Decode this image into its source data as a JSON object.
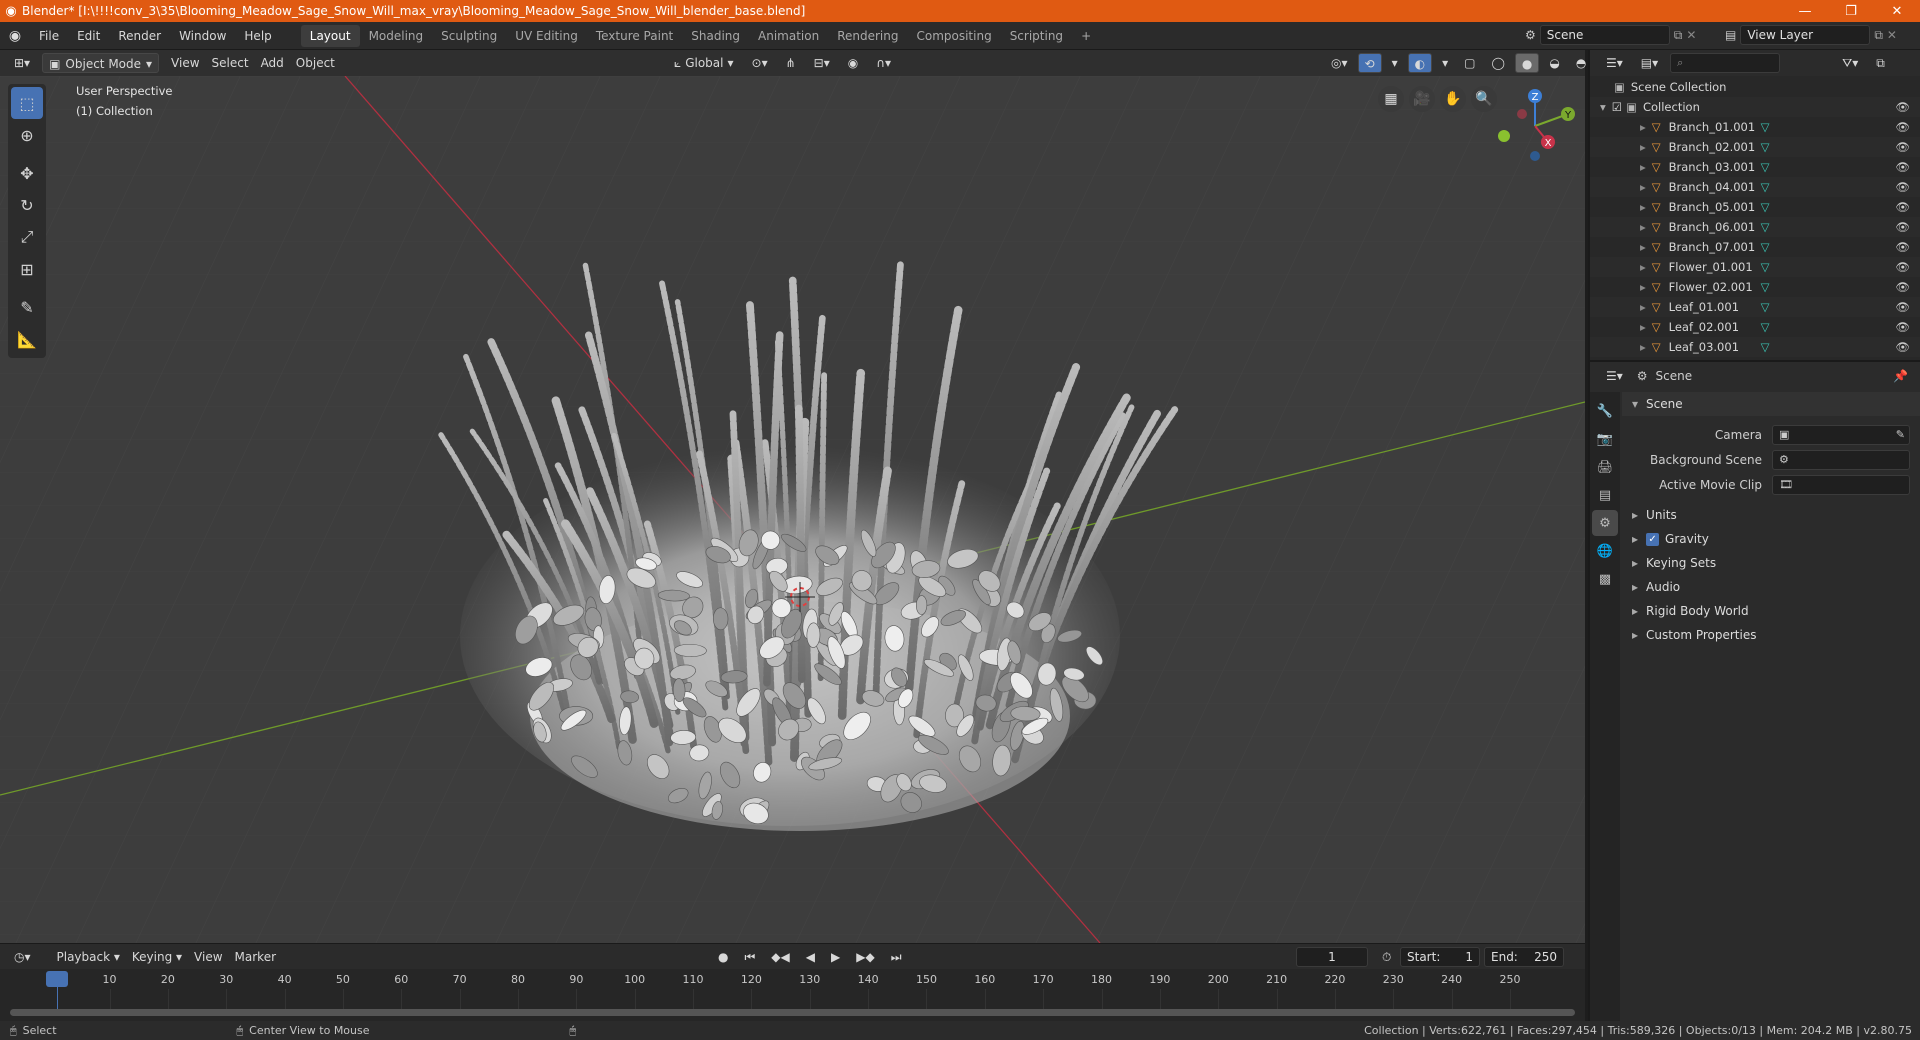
{
  "window": {
    "title": "Blender* [I:\\!!!!conv_3\\35\\Blooming_Meadow_Sage_Snow_Will_max_vray\\Blooming_Meadow_Sage_Snow_Will_blender_base.blend]",
    "minimize": "—",
    "maximize": "❐",
    "close": "✕"
  },
  "menubar": {
    "items": [
      "File",
      "Edit",
      "Render",
      "Window",
      "Help"
    ],
    "workspaces": [
      "Layout",
      "Modeling",
      "Sculpting",
      "UV Editing",
      "Texture Paint",
      "Shading",
      "Animation",
      "Rendering",
      "Compositing",
      "Scripting"
    ],
    "active_workspace": "Layout",
    "add_tab": "+",
    "scene_name": "Scene",
    "view_layer_name": "View Layer"
  },
  "viewport_header": {
    "mode": "Object Mode",
    "menus": [
      "View",
      "Select",
      "Add",
      "Object"
    ],
    "orientation": "Global"
  },
  "viewport": {
    "perspective_label": "User Perspective",
    "collection_label": "(1) Collection",
    "gizmo": {
      "x": "X",
      "y": "Y",
      "z": "Z"
    }
  },
  "timeline": {
    "menus": [
      "Playback",
      "Keying",
      "View",
      "Marker"
    ],
    "current_frame": "1",
    "start_label": "Start:",
    "start_value": "1",
    "end_label": "End:",
    "end_value": "250",
    "ticks": [
      "1",
      "10",
      "20",
      "30",
      "40",
      "50",
      "60",
      "70",
      "80",
      "90",
      "100",
      "110",
      "120",
      "130",
      "140",
      "150",
      "160",
      "170",
      "180",
      "190",
      "200",
      "210",
      "220",
      "230",
      "240",
      "250"
    ]
  },
  "statusbar": {
    "select": "Select",
    "center_view": "Center View to Mouse",
    "stats": "Collection | Verts:622,761 | Faces:297,454 | Tris:589,326 | Objects:0/13 | Mem: 204.2 MB | v2.80.75"
  },
  "outliner": {
    "root": "Scene Collection",
    "collection": "Collection",
    "items": [
      "Branch_01.001",
      "Branch_02.001",
      "Branch_03.001",
      "Branch_04.001",
      "Branch_05.001",
      "Branch_06.001",
      "Branch_07.001",
      "Flower_01.001",
      "Flower_02.001",
      "Leaf_01.001",
      "Leaf_02.001",
      "Leaf_03.001"
    ]
  },
  "properties": {
    "header_title": "Scene",
    "panel_title": "Scene",
    "fields": [
      {
        "label": "Camera",
        "value": ""
      },
      {
        "label": "Background Scene",
        "value": ""
      },
      {
        "label": "Active Movie Clip",
        "value": ""
      }
    ],
    "sections": [
      "Units",
      "Gravity",
      "Keying Sets",
      "Audio",
      "Rigid Body World",
      "Custom Properties"
    ],
    "gravity_checked": true
  },
  "colors": {
    "titlebar": "#e05a12",
    "accent": "#4772b3",
    "x_axis": "#c8334a",
    "y_axis": "#7ba92e",
    "z_axis": "#3d7fd6"
  }
}
